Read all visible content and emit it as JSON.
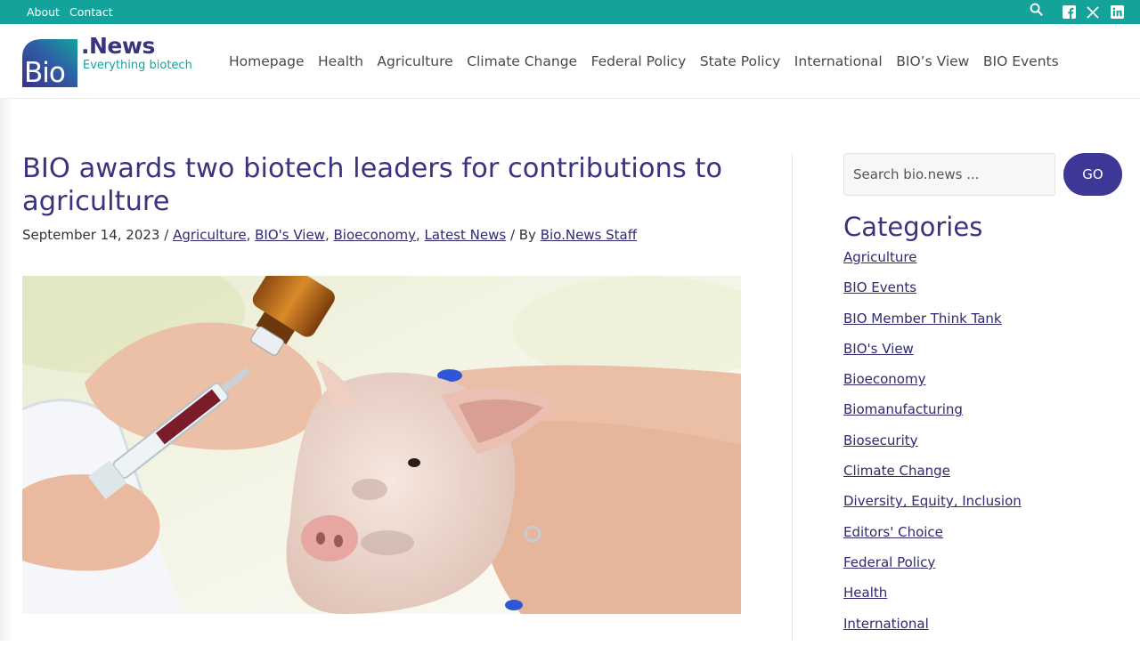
{
  "topbar": {
    "links": [
      "About",
      "Contact"
    ],
    "icons": [
      "search-icon",
      "facebook-icon",
      "x-icon",
      "linkedin-icon"
    ],
    "color": "#14a39a"
  },
  "logo": {
    "mark_text": "Bio",
    "name": ".News",
    "tagline": "Everything biotech"
  },
  "nav": {
    "items": [
      "Homepage",
      "Health",
      "Agriculture",
      "Climate Change",
      "Federal Policy",
      "State Policy",
      "International",
      "BIO’s View",
      "BIO Events"
    ]
  },
  "article": {
    "title": "BIO awards two biotech leaders for contributions to agriculture",
    "date": "September 14, 2023",
    "sep1": " / ",
    "categories": [
      "Agriculture",
      "BIO's View",
      "Bioeconomy",
      "Latest News"
    ],
    "comma": ", ",
    "by_prefix": " / By ",
    "author": "Bio.News Staff",
    "hero_image": "piglet-vaccination-photo"
  },
  "sidebar": {
    "search": {
      "placeholder": "Search bio.news ...",
      "button": "GO"
    },
    "categories_heading": "Categories",
    "categories": [
      "Agriculture",
      "BIO Events",
      "BIO Member Think Tank",
      "BIO's View",
      "Bioeconomy",
      "Biomanufacturing",
      "Biosecurity",
      "Climate Change",
      "Diversity, Equity, Inclusion",
      "Editors' Choice",
      "Federal Policy",
      "Health",
      "International"
    ]
  },
  "colors": {
    "brand_purple": "#3a3480",
    "teal": "#14a39a"
  }
}
